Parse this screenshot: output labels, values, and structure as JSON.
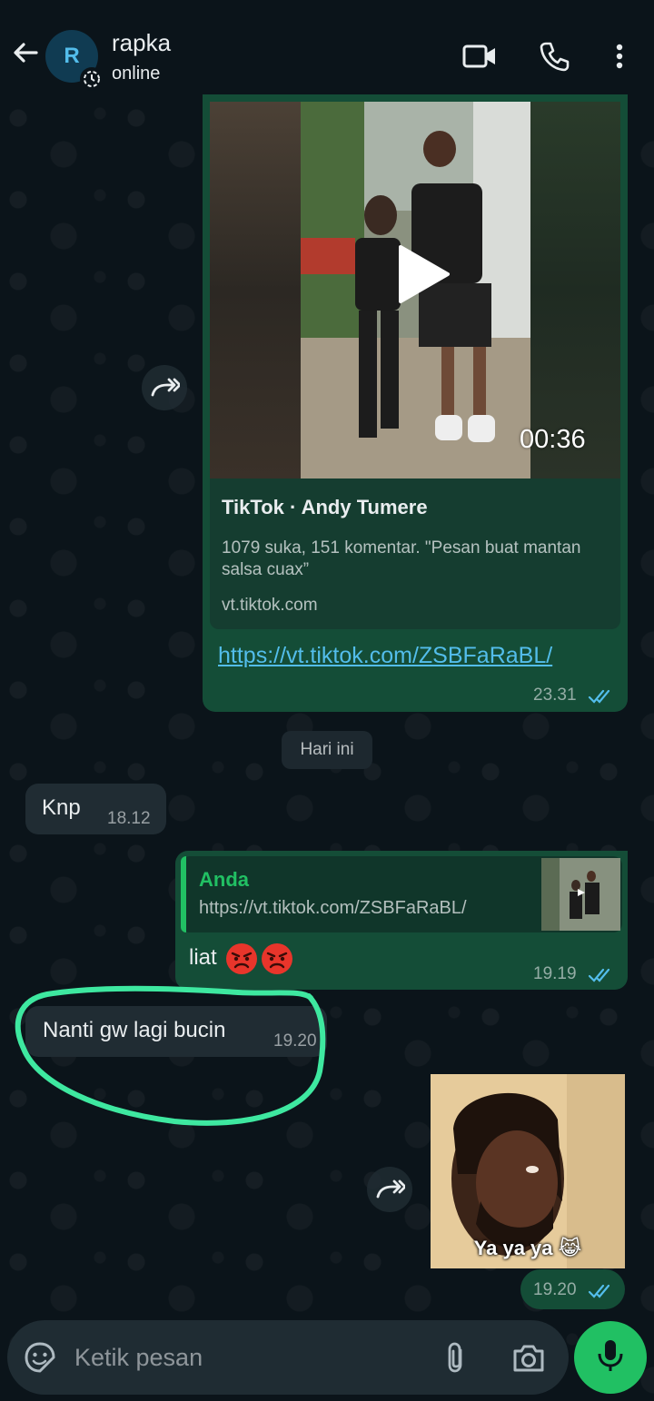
{
  "header": {
    "avatar_letter": "R",
    "contact_name": "rapka",
    "contact_status": "online"
  },
  "messages": {
    "tiktok": {
      "video_duration": "00:36",
      "link_title": "TikTok · Andy Tumere",
      "link_description": "1079 suka, 151 komentar. \"Pesan buat mantan salsa cuax”",
      "link_domain": "vt.tiktok.com",
      "url": "https://vt.tiktok.com/ZSBFaRaBL/",
      "time": "23.31"
    },
    "date_separator": "Hari ini",
    "knp": {
      "text": "Knp",
      "time": "18.12"
    },
    "reply": {
      "quote_author": "Anda",
      "quote_text": "https://vt.tiktok.com/ZSBFaRaBL/",
      "text": "liat",
      "time": "19.19"
    },
    "nanti": {
      "text": "Nanti gw lagi bucin",
      "time": "19.20"
    },
    "sticker": {
      "caption": "Ya ya ya 😹",
      "time": "19.20"
    }
  },
  "input": {
    "placeholder": "Ketik pesan"
  },
  "colors": {
    "background": "#0b141a",
    "outgoing_bubble": "#144d37",
    "incoming_bubble": "#202c33",
    "accent_green": "#21c063",
    "link_blue": "#53bdeb",
    "highlight_circle": "#3ee8a0"
  }
}
